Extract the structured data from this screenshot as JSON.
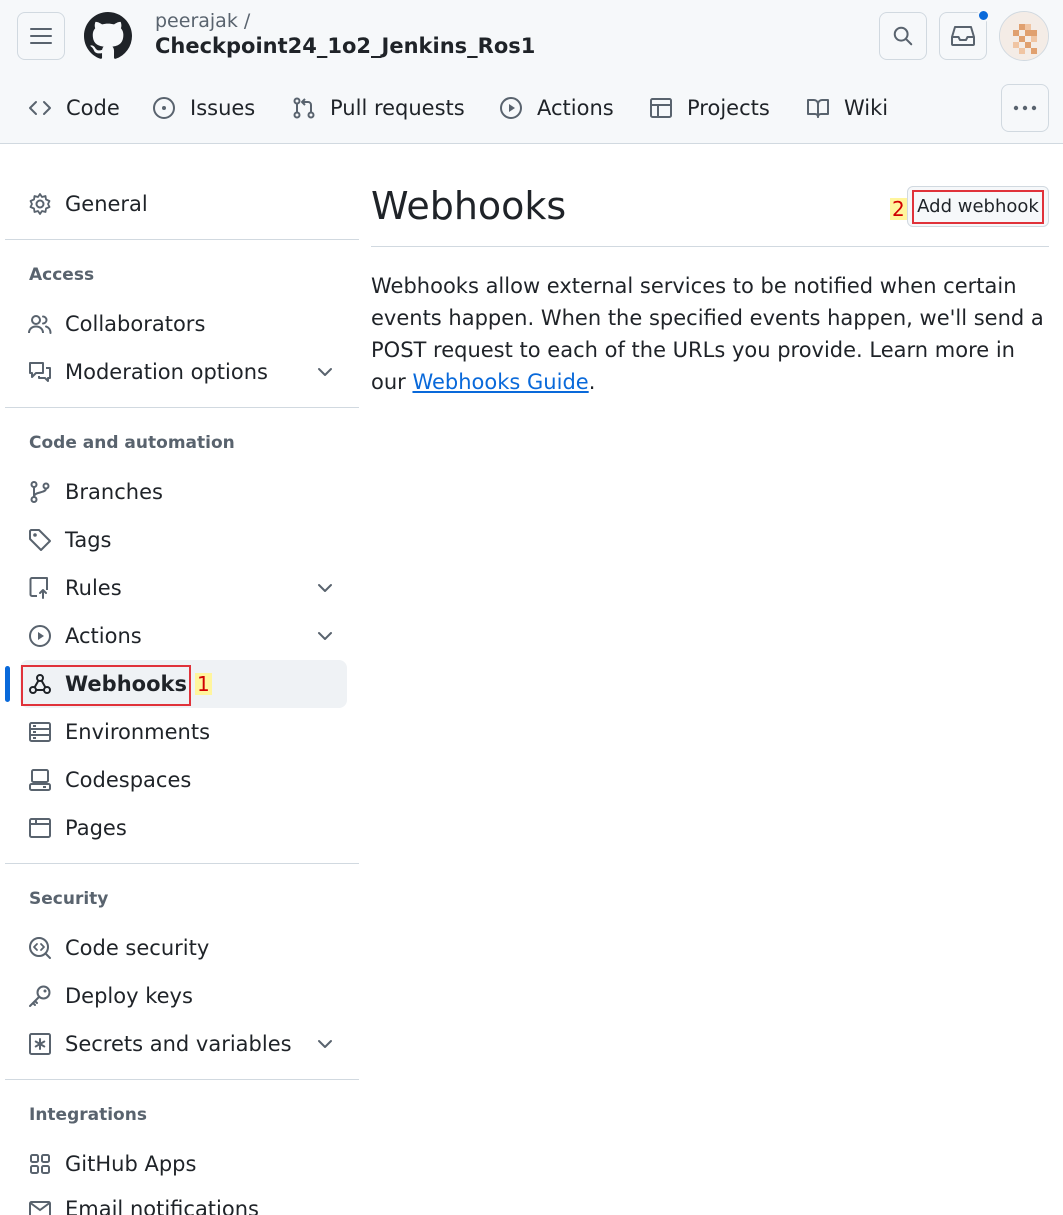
{
  "header": {
    "owner": "peerajak /",
    "repo": "Checkpoint24_1o2_Jenkins_Ros1"
  },
  "repo_nav": [
    {
      "label": "Code",
      "icon": "code-icon"
    },
    {
      "label": "Issues",
      "icon": "issue-opened-icon"
    },
    {
      "label": "Pull requests",
      "icon": "git-pull-request-icon"
    },
    {
      "label": "Actions",
      "icon": "play-icon"
    },
    {
      "label": "Projects",
      "icon": "table-icon"
    },
    {
      "label": "Wiki",
      "icon": "book-icon"
    }
  ],
  "sidebar": {
    "general": "General",
    "access_heading": "Access",
    "collaborators": "Collaborators",
    "moderation": "Moderation options",
    "code_automation_heading": "Code and automation",
    "branches": "Branches",
    "tags": "Tags",
    "rules": "Rules",
    "actions": "Actions",
    "webhooks": "Webhooks",
    "environments": "Environments",
    "codespaces": "Codespaces",
    "pages": "Pages",
    "security_heading": "Security",
    "code_security": "Code security",
    "deploy_keys": "Deploy keys",
    "secrets": "Secrets and variables",
    "integrations_heading": "Integrations",
    "github_apps": "GitHub Apps",
    "email_notifications": "Email notifications"
  },
  "annotations": {
    "one": "1",
    "two": "2"
  },
  "main": {
    "title": "Webhooks",
    "add_button": "Add webhook",
    "description": "Webhooks allow external services to be notified when certain events happen. When the specified events happen, we'll send a POST request to each of the URLs you provide. Learn more in our ",
    "guide_link": "Webhooks Guide",
    "period": "."
  },
  "colors": {
    "accent": "#0969da",
    "annotation_red": "#e0323a",
    "annotation_highlight": "#fff59d"
  }
}
